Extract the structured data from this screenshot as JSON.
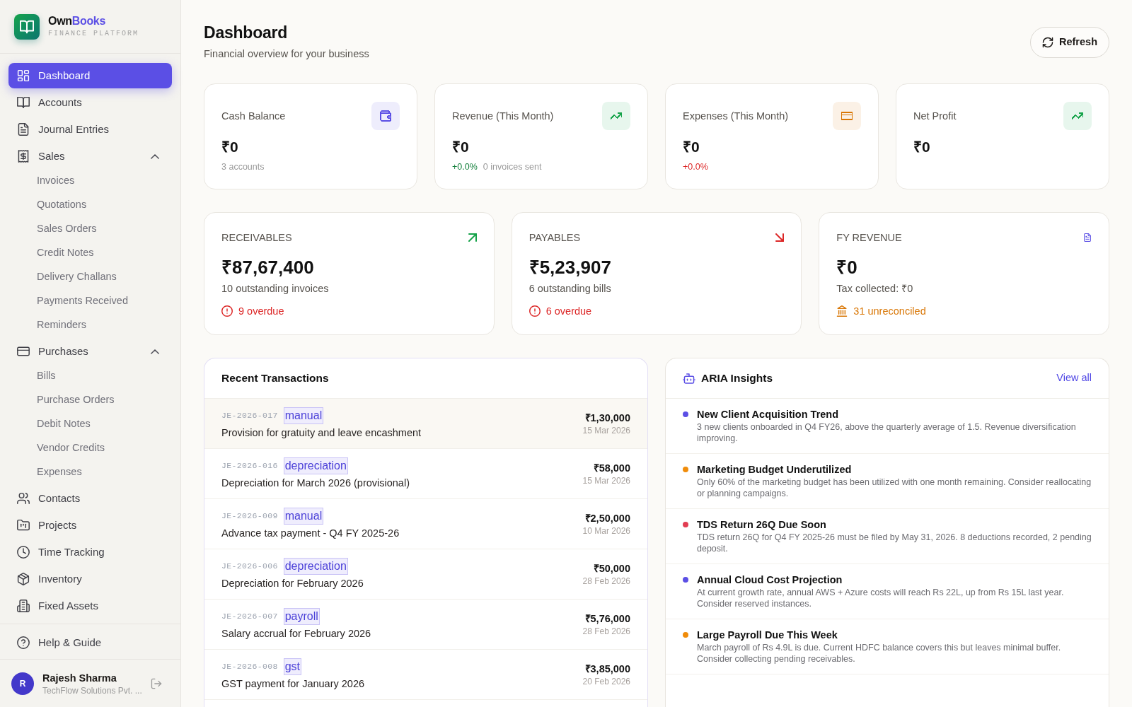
{
  "sidebar": {
    "brand": {
      "name": "Own",
      "name_accent": "Books",
      "tagline": "FINANCE PLATFORM"
    },
    "nav": [
      {
        "kind": "link",
        "label": "Dashboard",
        "selected": true
      },
      {
        "kind": "link",
        "label": "Accounts",
        "selected": false
      },
      {
        "kind": "link",
        "label": "Journal Entries",
        "selected": false
      },
      {
        "kind": "group",
        "label": "Sales",
        "selected": false,
        "expanded": true,
        "children": [
          {
            "label": "Invoices",
            "selected": false
          },
          {
            "label": "Quotations",
            "selected": false
          },
          {
            "label": "Sales Orders",
            "selected": false
          },
          {
            "label": "Credit Notes",
            "selected": false
          },
          {
            "label": "Delivery Challans",
            "selected": false
          },
          {
            "label": "Payments Received",
            "selected": false
          },
          {
            "label": "Reminders",
            "selected": false
          }
        ]
      },
      {
        "kind": "group",
        "label": "Purchases",
        "selected": false,
        "expanded": true,
        "children": [
          {
            "label": "Bills",
            "selected": false
          },
          {
            "label": "Purchase Orders",
            "selected": false
          },
          {
            "label": "Debit Notes",
            "selected": false
          },
          {
            "label": "Vendor Credits",
            "selected": false
          },
          {
            "label": "Expenses",
            "selected": false
          }
        ]
      },
      {
        "kind": "link",
        "label": "Contacts",
        "selected": false
      },
      {
        "kind": "link",
        "label": "Projects",
        "selected": false
      },
      {
        "kind": "link",
        "label": "Time Tracking",
        "selected": false
      },
      {
        "kind": "link",
        "label": "Inventory",
        "selected": false
      },
      {
        "kind": "link",
        "label": "Fixed Assets",
        "selected": false
      }
    ],
    "help_link": "Help & Guide",
    "user": {
      "initial": "R",
      "name": "Rajesh Sharma",
      "company": "TechFlow Solutions Pvt. ..."
    }
  },
  "header": {
    "title": "Dashboard",
    "subtitle": "Financial overview for your business",
    "refresh_button": "Refresh"
  },
  "stat_cards": [
    {
      "label": "Cash Balance",
      "value": "₹0",
      "color": "#5b4fe5",
      "caption": "3 accounts"
    },
    {
      "label": "Revenue (This Month)",
      "value": "₹0",
      "color": "#16a34a",
      "change": {
        "text": "+0.0%",
        "color": "#15803d"
      },
      "caption": "0 invoices sent"
    },
    {
      "label": "Expenses (This Month)",
      "value": "₹0",
      "color": "#d97706",
      "change": {
        "text": "+0.0%",
        "color": "#dc2626"
      }
    },
    {
      "label": "Net Profit",
      "value": "₹0",
      "color": "#16a34a"
    }
  ],
  "summary_cards": [
    {
      "label": "RECEIVABLES",
      "value": "₹87,67,400",
      "caption": "10 outstanding invoices",
      "color": "#16a34a",
      "alert": {
        "text": "9 overdue",
        "color": "#dc2626"
      }
    },
    {
      "label": "PAYABLES",
      "value": "₹5,23,907",
      "caption": "6 outstanding bills",
      "color": "#dc2626",
      "alert": {
        "text": "6 overdue",
        "color": "#dc2626"
      }
    },
    {
      "label": "FY REVENUE",
      "value": "₹0",
      "caption": "Tax collected: ₹0",
      "color": "#5b4fe5",
      "alert": {
        "text": "31 unreconciled",
        "color": "#d97706"
      }
    }
  ],
  "recent_transactions": {
    "title": "Recent Transactions",
    "rows": [
      {
        "ref": "JE-2026-017",
        "tag": "manual",
        "description": "Provision for gratuity and leave encashment",
        "amount": "₹1,30,000",
        "date": "15 Mar 2026",
        "selected": true
      },
      {
        "ref": "JE-2026-016",
        "tag": "depreciation",
        "description": "Depreciation for March 2026 (provisional)",
        "amount": "₹58,000",
        "date": "15 Mar 2026",
        "selected": false
      },
      {
        "ref": "JE-2026-009",
        "tag": "manual",
        "description": "Advance tax payment - Q4 FY 2025-26",
        "amount": "₹2,50,000",
        "date": "10 Mar 2026",
        "selected": false
      },
      {
        "ref": "JE-2026-006",
        "tag": "depreciation",
        "description": "Depreciation for February 2026",
        "amount": "₹50,000",
        "date": "28 Feb 2026",
        "selected": false
      },
      {
        "ref": "JE-2026-007",
        "tag": "payroll",
        "description": "Salary accrual for February 2026",
        "amount": "₹5,76,000",
        "date": "28 Feb 2026",
        "selected": false
      },
      {
        "ref": "JE-2026-008",
        "tag": "gst",
        "description": "GST payment for January 2026",
        "amount": "₹3,85,000",
        "date": "20 Feb 2026",
        "selected": false
      }
    ]
  },
  "insights": {
    "title": "ARIA Insights",
    "view_all": "View all",
    "items": [
      {
        "title": "New Client Acquisition Trend",
        "body": "3 new clients onboarded in Q4 FY26, above the quarterly average of 1.5. Revenue diversification improving.",
        "color": "#5b4fe5"
      },
      {
        "title": "Marketing Budget Underutilized",
        "body": "Only 60% of the marketing budget has been utilized with one month remaining. Consider reallocating or planning campaigns.",
        "color": "#f08c0a"
      },
      {
        "title": "TDS Return 26Q Due Soon",
        "body": "TDS return 26Q for Q4 FY 2025-26 must be filed by May 31, 2026. 8 deductions recorded, 2 pending deposit.",
        "color": "#e23d52"
      },
      {
        "title": "Annual Cloud Cost Projection",
        "body": "At current growth rate, annual AWS + Azure costs will reach Rs 22L, up from Rs 15L last year. Consider reserved instances.",
        "color": "#5b4fe5"
      },
      {
        "title": "Large Payroll Due This Week",
        "body": "March payroll of Rs 4.9L is due. Current HDFC balance covers this but leaves minimal buffer. Consider collecting pending receivables.",
        "color": "#f08c0a"
      }
    ]
  }
}
